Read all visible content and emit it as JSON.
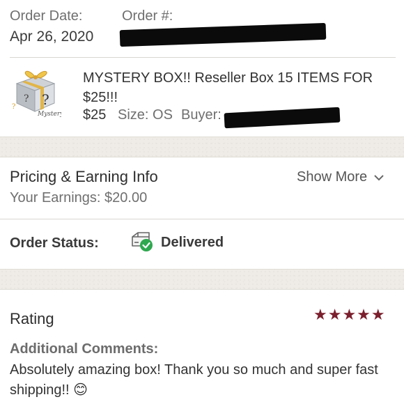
{
  "order": {
    "date_label": "Order Date:",
    "date_value": "Apr 26, 2020",
    "number_label": "Order #:"
  },
  "item": {
    "title": "MYSTERY BOX!! Reseller Box 15 ITEMS FOR $25!!!",
    "price": "$25",
    "size": "Size: OS",
    "buyer_label": "Buyer:",
    "thumbnail_caption": "Mystery",
    "thumbnail_symbol": "?"
  },
  "pricing": {
    "title": "Pricing & Earning Info",
    "show_more": "Show More",
    "earnings": "Your Earnings: $20.00"
  },
  "status": {
    "label": "Order Status:",
    "value": "Delivered",
    "icon": "package-delivered-icon"
  },
  "rating": {
    "title": "Rating",
    "stars": 5,
    "stars_text": "★★★★★",
    "comments_label": "Additional Comments:",
    "comments_text": "Absolutely amazing box! Thank you so much and super fast shipping!! 😊"
  },
  "colors": {
    "star": "#7b1f2d",
    "check": "#2fa84f",
    "band": "#efece7"
  }
}
